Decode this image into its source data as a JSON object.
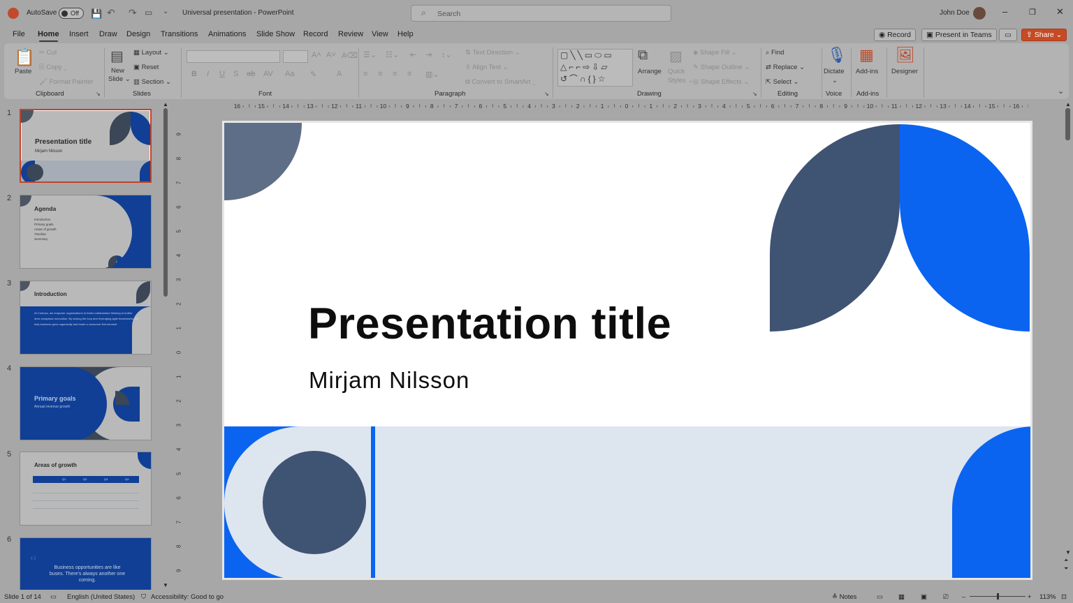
{
  "app": {
    "autosave_label": "AutoSave",
    "autosave_state": "Off",
    "title": "Universal presentation  -  PowerPoint",
    "search_placeholder": "Search",
    "user_name": "John Doe"
  },
  "tabs": [
    "File",
    "Home",
    "Insert",
    "Draw",
    "Design",
    "Transitions",
    "Animations",
    "Slide Show",
    "Record",
    "Review",
    "View",
    "Help"
  ],
  "tab_actions": {
    "record": "Record",
    "present_in_teams": "Present in Teams",
    "share": "Share"
  },
  "ribbon": {
    "clipboard": {
      "paste": "Paste",
      "cut": "Cut",
      "copy": "Copy",
      "format_painter": "Format Painter",
      "group": "Clipboard"
    },
    "slides": {
      "new_slide": "New",
      "new_slide2": "Slide",
      "layout": "Layout",
      "reset": "Reset",
      "section": "Section",
      "group": "Slides"
    },
    "font": {
      "group": "Font"
    },
    "paragraph": {
      "text_direction": "Text Direction",
      "align_text": "Align Text",
      "convert_smartart": "Convert to SmartArt",
      "group": "Paragraph"
    },
    "drawing": {
      "arrange": "Arrange",
      "quick_styles": "Quick",
      "quick_styles2": "Styles",
      "shape_fill": "Shape Fill",
      "shape_outline": "Shape Outline",
      "shape_effects": "Shape Effects",
      "group": "Drawing"
    },
    "editing": {
      "find": "Find",
      "replace": "Replace",
      "select": "Select",
      "group": "Editing"
    },
    "voice": {
      "dictate": "Dictate",
      "group": "Voice"
    },
    "addins": {
      "addins": "Add-ins",
      "group": "Add-ins"
    },
    "designer": {
      "designer": "Designer"
    }
  },
  "thumbnails": [
    {
      "num": "1",
      "title": "Presentation title",
      "subtitle": "Mirjam Nilsson"
    },
    {
      "num": "2",
      "title": "Agenda",
      "lines": [
        "Introduction",
        "Primary goals",
        "Areas of growth",
        "Timeline",
        "Summary"
      ]
    },
    {
      "num": "3",
      "title": "Introduction",
      "body": "At Contoso, we empower organizations to foster collaborative thinking to further drive workplace innovation. By closing the loop and leveraging agile frameworks, we help business grow organically and foster a consumer first mindset."
    },
    {
      "num": "4",
      "title": "Primary goals",
      "subtitle": "Annual revenue growth"
    },
    {
      "num": "5",
      "title": "Areas of growth",
      "headers": [
        "",
        "Q1",
        "Q2",
        "Q3",
        "Q4"
      ]
    },
    {
      "num": "6",
      "quote": "Business opportunities are like buses. There's always another one coming."
    }
  ],
  "slide": {
    "title": "Presentation title",
    "subtitle": "Mirjam Nilsson"
  },
  "ruler_h": [
    "16",
    "15",
    "14",
    "13",
    "12",
    "11",
    "10",
    "9",
    "8",
    "7",
    "6",
    "5",
    "4",
    "3",
    "2",
    "1",
    "0",
    "1",
    "2",
    "3",
    "4",
    "5",
    "6",
    "7",
    "8",
    "9",
    "10",
    "11",
    "12",
    "13",
    "14",
    "15",
    "16"
  ],
  "ruler_v": [
    "9",
    "8",
    "7",
    "6",
    "5",
    "4",
    "3",
    "2",
    "1",
    "0",
    "1",
    "2",
    "3",
    "4",
    "5",
    "6",
    "7",
    "8",
    "9"
  ],
  "status": {
    "slide_of": "Slide 1 of 14",
    "language": "English (United States)",
    "accessibility": "Accessibility: Good to go",
    "notes": "Notes",
    "zoom": "113%"
  },
  "colors": {
    "accent_blue": "#0a64f0",
    "slate": "#3f5373",
    "light_blue_band": "#dde5ef",
    "grey_slate": "#5e6e87",
    "share_orange": "#c64a23"
  }
}
